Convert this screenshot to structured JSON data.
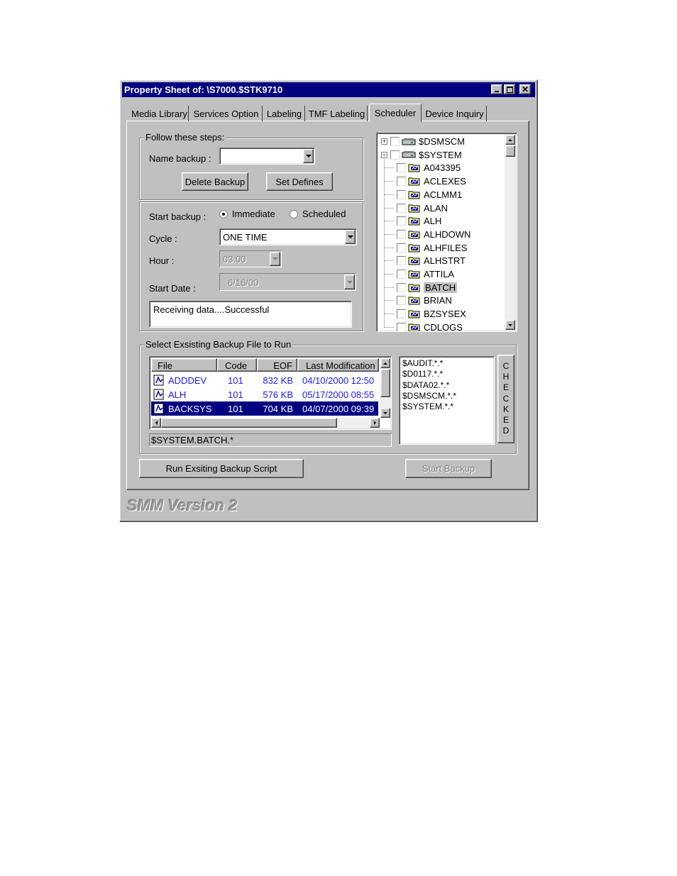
{
  "window": {
    "title": "Property Sheet of: \\S7000.$STK9710",
    "controls": {
      "minimize": "minimize-icon",
      "maximize": "maximize-icon",
      "close": "close-icon"
    }
  },
  "tabs": [
    {
      "label": "Media Library",
      "active": false
    },
    {
      "label": "Services Option",
      "active": false
    },
    {
      "label": "Labeling",
      "active": false
    },
    {
      "label": "TMF Labeling",
      "active": false
    },
    {
      "label": "Scheduler",
      "active": true
    },
    {
      "label": "Device Inquiry",
      "active": false
    }
  ],
  "steps": {
    "group_label": "Follow these steps:",
    "name_backup_label": "Name backup :",
    "name_backup_value": "",
    "delete_button": "Delete Backup",
    "set_defines_button": "Set Defines"
  },
  "schedule": {
    "start_backup_label": "Start backup :",
    "immediate_label": "Immediate",
    "scheduled_label": "Scheduled",
    "selected": "Immediate",
    "cycle_label": "Cycle :",
    "cycle_value": "ONE TIME",
    "hour_label": "Hour :",
    "hour_value": "03:00",
    "start_date_label": "Start Date :",
    "start_date_value": "6/16/00",
    "status_text": "Receiving data....Successful"
  },
  "tree": {
    "items": [
      {
        "label": "$DSMSCM",
        "level": 0,
        "type": "drive",
        "expander": "+"
      },
      {
        "label": "$SYSTEM",
        "level": 0,
        "type": "drive",
        "expander": "-"
      },
      {
        "label": "A043395",
        "level": 1,
        "type": "folder"
      },
      {
        "label": "ACLEXES",
        "level": 1,
        "type": "folder"
      },
      {
        "label": "ACLMM1",
        "level": 1,
        "type": "folder"
      },
      {
        "label": "ALAN",
        "level": 1,
        "type": "folder"
      },
      {
        "label": "ALH",
        "level": 1,
        "type": "folder"
      },
      {
        "label": "ALHDOWN",
        "level": 1,
        "type": "folder"
      },
      {
        "label": "ALHFILES",
        "level": 1,
        "type": "folder"
      },
      {
        "label": "ALHSTRT",
        "level": 1,
        "type": "folder"
      },
      {
        "label": "ATTILA",
        "level": 1,
        "type": "folder"
      },
      {
        "label": "BATCH",
        "level": 1,
        "type": "folder",
        "selected": true
      },
      {
        "label": "BRIAN",
        "level": 1,
        "type": "folder"
      },
      {
        "label": "BZSYSEX",
        "level": 1,
        "type": "folder"
      },
      {
        "label": "CDLOGS",
        "level": 1,
        "type": "folder"
      }
    ]
  },
  "backup_files": {
    "group_label": "Select Exsisting Backup File to Run",
    "columns": [
      "File",
      "Code",
      "EOF",
      "Last Modification"
    ],
    "rows": [
      {
        "file": "ADDDEV",
        "code": "101",
        "eof": "832 KB",
        "modified": "04/10/2000 12:50",
        "selected": false
      },
      {
        "file": "ALH",
        "code": "101",
        "eof": "576 KB",
        "modified": "05/17/2000 08:55",
        "selected": false
      },
      {
        "file": "BACKSYS",
        "code": "101",
        "eof": "704 KB",
        "modified": "04/07/2000 09:39",
        "selected": true
      }
    ],
    "path_value": "$SYSTEM.BATCH.*",
    "checked_items": [
      "$AUDIT.*.*",
      "$D0117.*.*",
      "$DATA02.*.*",
      "$DSMSCM.*.*",
      "$SYSTEM.*.*"
    ],
    "checked_label": "CHECKED"
  },
  "actions": {
    "run_button": "Run Exsiting Backup Script",
    "start_button": "Start Backup"
  },
  "footer": {
    "version": "SMM Version 2"
  },
  "colors": {
    "titlebar": "#000080",
    "face": "#c0c0c0",
    "link_blue": "#1a1aff",
    "selection": "#000080"
  }
}
